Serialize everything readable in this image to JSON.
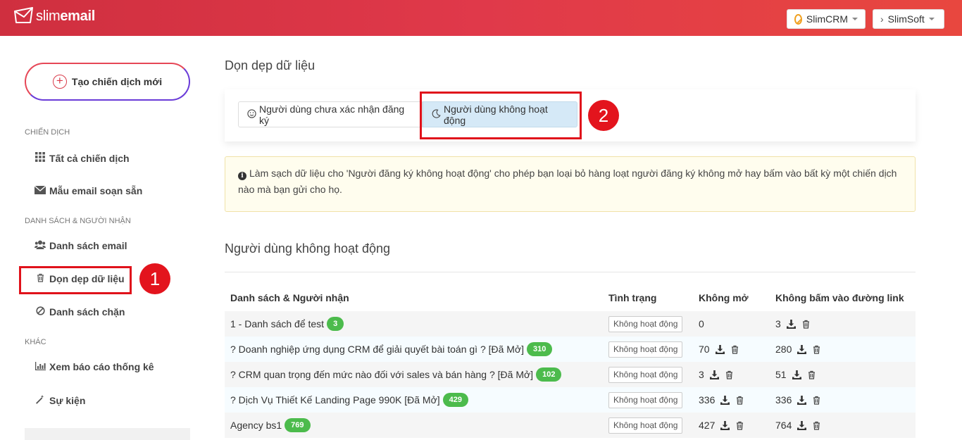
{
  "header": {
    "logo_light": "slim",
    "logo_bold": "email",
    "crm_label": "SlimCRM",
    "soft_label": "SlimSoft"
  },
  "sidebar": {
    "create_label": "Tạo chiến dịch mới",
    "sections": [
      {
        "title": "CHIẾN DỊCH"
      },
      {
        "title": "DANH SÁCH & NGƯỜI NHẬN"
      },
      {
        "title": "KHÁC"
      }
    ],
    "items": [
      {
        "label": "Tất cả chiến dịch",
        "icon": "grid-icon"
      },
      {
        "label": "Mẫu email soạn sẵn",
        "icon": "envelope-icon"
      },
      {
        "label": "Danh sách email",
        "icon": "users-icon"
      },
      {
        "label": "Dọn dẹp dữ liệu",
        "icon": "trash-icon"
      },
      {
        "label": "Danh sách chặn",
        "icon": "ban-icon"
      },
      {
        "label": "Xem báo cáo thống kê",
        "icon": "bar-chart-icon"
      },
      {
        "label": "Sự kiện",
        "icon": "magic-wand-icon"
      }
    ],
    "annotation_1": "1"
  },
  "main": {
    "title": "Dọn dẹp dữ liệu",
    "tabs": [
      {
        "label": "Người dùng chưa xác nhận đăng ký",
        "icon": "smile-icon"
      },
      {
        "label": "Người dùng không hoạt động",
        "icon": "moon-icon"
      }
    ],
    "annotation_2": "2",
    "info_text": "Làm sạch dữ liệu cho 'Người đăng ký không hoạt động' cho phép bạn loại bỏ hàng loạt người đăng ký không mở hay bấm vào bất kỳ một chiến dịch nào mà bạn gửi cho họ.",
    "section_title": "Người dùng không hoạt động",
    "table": {
      "headers": [
        "Danh sách & Người nhận",
        "Tình trạng",
        "Không mở",
        "Không bấm vào đường link"
      ],
      "rows": [
        {
          "name": "1 - Danh sách để test",
          "count": "3",
          "status": "Không hoạt động",
          "not_opened": "0",
          "not_clicked": "3",
          "open_actions": false
        },
        {
          "name": "? Doanh nghiệp ứng dụng CRM để giải quyết bài toán gì ? [Đã Mở]",
          "count": "310",
          "status": "Không hoạt động",
          "not_opened": "70",
          "not_clicked": "280",
          "open_actions": true
        },
        {
          "name": "? CRM quan trọng đến mức nào đối với sales và bán hàng ? [Đã Mở]",
          "count": "102",
          "status": "Không hoạt động",
          "not_opened": "3",
          "not_clicked": "51",
          "open_actions": true
        },
        {
          "name": "? Dịch Vụ Thiết Kế Landing Page 990K [Đã Mở]",
          "count": "429",
          "status": "Không hoạt động",
          "not_opened": "336",
          "not_clicked": "336",
          "open_actions": true
        },
        {
          "name": "Agency bs1",
          "count": "769",
          "status": "Không hoạt động",
          "not_opened": "427",
          "not_clicked": "764",
          "open_actions": true
        }
      ]
    }
  }
}
